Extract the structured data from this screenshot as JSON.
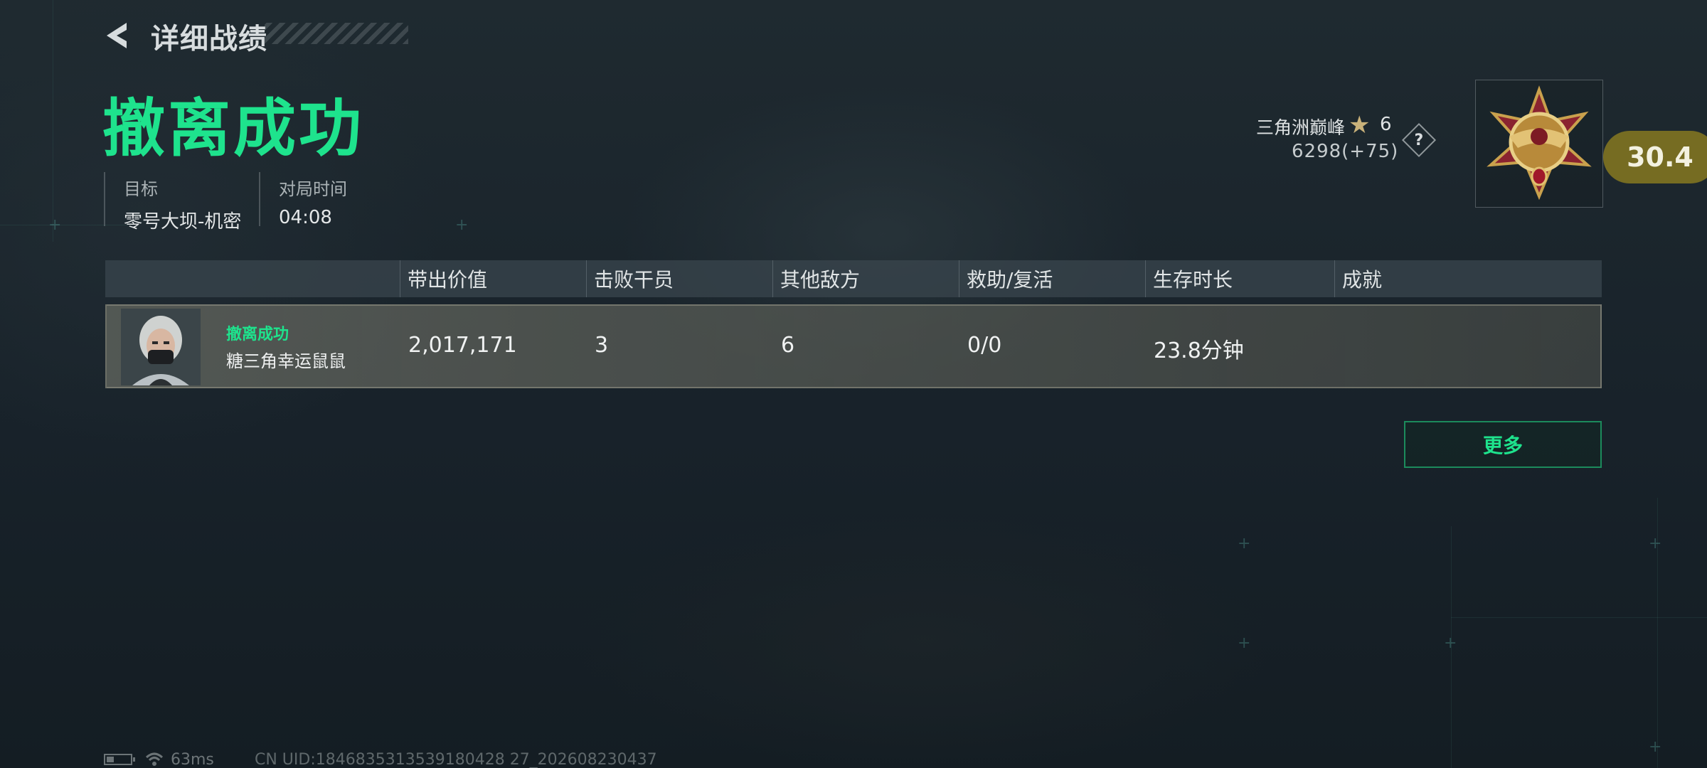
{
  "header": {
    "title": "详细战绩"
  },
  "result": {
    "title": "撤离成功",
    "objective_label": "目标",
    "objective_value": "零号大坝-机密",
    "duration_label": "对局时间",
    "duration_value": "04:08"
  },
  "rank": {
    "name": "三角洲巅峰",
    "level": "6",
    "score": "6298(+75)",
    "help_label": "?",
    "rating": "30.4"
  },
  "table": {
    "headers": [
      "带出价值",
      "击败干员",
      "其他敌方",
      "救助/复活",
      "生存时长",
      "成就"
    ],
    "rows": [
      {
        "status": "撤离成功",
        "player": "糖三角幸运鼠鼠",
        "value": "2,017,171",
        "kills": "3",
        "other_enemies": "6",
        "assist_revive": "0/0",
        "survival_time": "23.8分钟",
        "achievement": ""
      }
    ]
  },
  "more_button": "更多",
  "footer": {
    "ping": "63ms",
    "uid": "CN UID:1846835313539180428 27_202608230437"
  },
  "colors": {
    "accent": "#1ee38d",
    "rating_pill": "#766c22"
  }
}
